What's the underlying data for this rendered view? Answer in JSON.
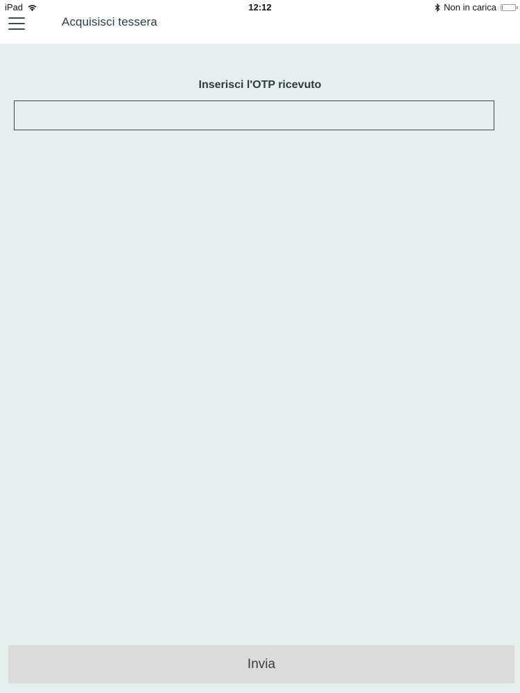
{
  "status_bar": {
    "device": "iPad",
    "time": "12:12",
    "charging_status": "Non in carica",
    "battery_level_fraction": 0.08,
    "icons": [
      "wifi-icon",
      "bluetooth-icon",
      "battery-icon"
    ]
  },
  "nav_bar": {
    "menu_icon": "hamburger-menu-icon",
    "title": "Acquisisci tessera"
  },
  "form": {
    "otp_label": "Inserisci l'OTP ricevuto",
    "otp_value": "",
    "otp_placeholder": ""
  },
  "actions": {
    "submit_label": "Invia"
  },
  "colors": {
    "background": "#e6eeee",
    "bar_background": "#ffffff",
    "text": "#2e3b3f",
    "button_background": "#dbdbdb",
    "battery_low": "#e23b3b"
  }
}
